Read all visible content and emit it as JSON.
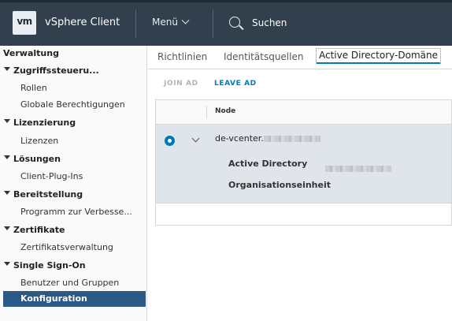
{
  "header": {
    "logo_text": "vm",
    "app_title": "vSphere Client",
    "menu_label": "Menü",
    "search_label": "Suchen",
    "bg_color": "#32404e"
  },
  "sidebar": {
    "title": "Verwaltung",
    "groups": [
      {
        "label": "Zugriffssteueru...",
        "items": [
          "Rollen",
          "Globale Berechtigungen"
        ]
      },
      {
        "label": "Lizenzierung",
        "items": [
          "Lizenzen"
        ]
      },
      {
        "label": "Lösungen",
        "items": [
          "Client-Plug-Ins"
        ]
      },
      {
        "label": "Bereitstellung",
        "items": [
          "Programm zur Verbesse..."
        ]
      },
      {
        "label": "Zertifikate",
        "items": [
          "Zertifikatsverwaltung"
        ]
      },
      {
        "label": "Single Sign-On",
        "items": [
          "Benutzer und Gruppen",
          "Konfiguration"
        ]
      }
    ],
    "active_item": "Konfiguration",
    "active_color": "#2c5a87"
  },
  "tabs": [
    "Richtlinien",
    "Identitätsquellen",
    "Active Directory-Domäne"
  ],
  "active_tab": "Active Directory-Domäne",
  "actions": {
    "join": "JOIN AD",
    "leave": "LEAVE AD"
  },
  "grid": {
    "column": "Node",
    "row": {
      "node_prefix": "de-vcenter.",
      "details": [
        {
          "label": "Active Directory"
        },
        {
          "label": "Organisationseinheit"
        }
      ]
    }
  },
  "accent_color": "#0079b8"
}
